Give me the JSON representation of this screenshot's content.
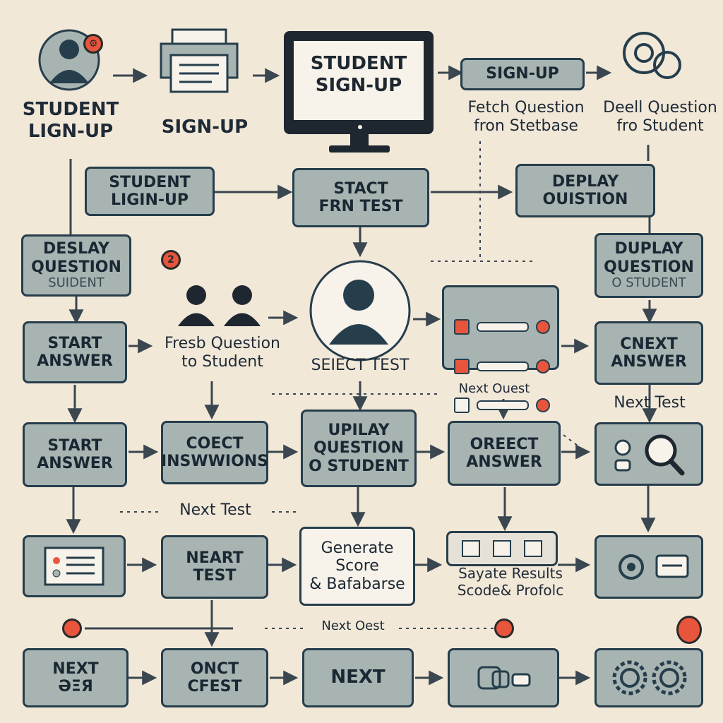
{
  "colors": {
    "background": "#f2e8d8",
    "box_fill": "#a7b4b1",
    "border": "#263e4c",
    "accent_red": "#e8553d",
    "text": "#1b2733"
  },
  "header": {
    "student_login": "STUDENT\nLIGN-UP",
    "signup": "SIGN-UP",
    "monitor_text": "STUDENT\nSIGN-UP",
    "signup_box": "SIGN-UP",
    "fetch_question": "Fetch Question\nfron Stetbase",
    "deli_question": "Deell Question\nfro Student"
  },
  "row2": {
    "student_login_box": "STUDENT\nLIGIN-UP",
    "start_test": "STACT\nFRN TEST",
    "display_question": "DEPLAY\nOUISTION"
  },
  "row3": {
    "left_box_line1": "DESLAY\nQUESTION",
    "left_box_line2": "SUIDENT",
    "right_box_line1": "DUPLAY\nQUESTION",
    "right_box_line2": "O STUDENT",
    "badge": "2"
  },
  "row4": {
    "start_answer": "START\nANSWER",
    "fresh_question": "Fresb Question\nto Student",
    "select_test": "SEIECT TEST",
    "next_answer": "CNEXT\nANSWER",
    "next_quest": "Next Ouest",
    "next_test": "Next Test"
  },
  "row5": {
    "start_answer": "START\nANSWER",
    "coect": "COECT\nINSWWIONS",
    "uplay": "UPILAY\nQUESTION\nO STUDENT",
    "orect_answer": "OREECT\nANSWER",
    "next_test_label": "Next Test"
  },
  "row6": {
    "neart_test": "NEART\nTEST",
    "generate_score": "Generate\nScore\n& Bafabarse",
    "save_results": "Sayate Results\nScode& Profolc"
  },
  "row7": {
    "next_quest_label": "Next Oest",
    "next_box": "NEXT",
    "next_box_sub": "ӘΞЯ",
    "onct": "ONCT\nCFEST",
    "next_center": "NEXT"
  }
}
